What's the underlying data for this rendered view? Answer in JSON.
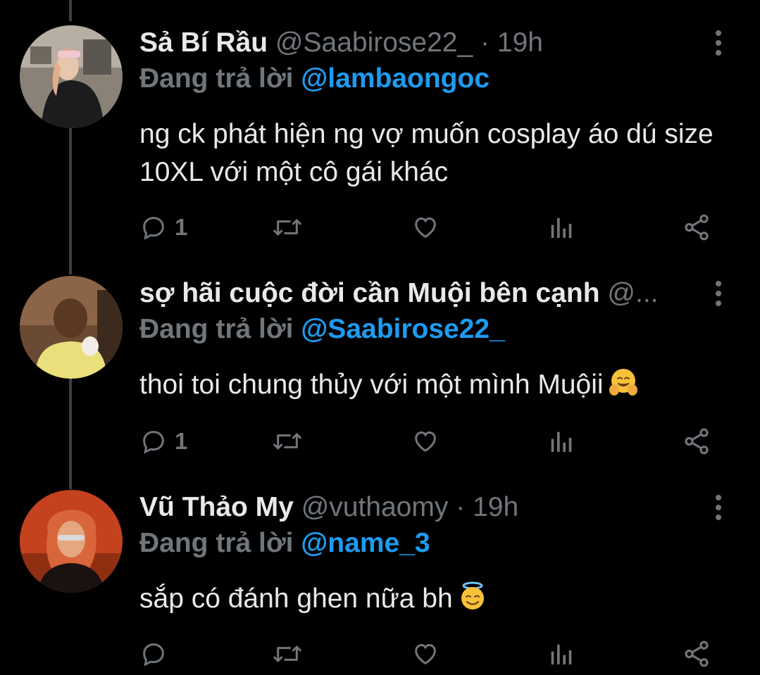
{
  "tweets": [
    {
      "name": "Sả Bí Rầu",
      "handle": "@Saabirose22_",
      "dot": "·",
      "time": "19h",
      "replying_label": "Đang trả lời",
      "replying_to": "@lambaongoc",
      "text": "ng ck phát hiện ng vợ muốn cosplay áo dú size 10XL với một cô gái khác",
      "reply_count": "1",
      "emoji": ""
    },
    {
      "name": "sợ hãi cuộc đời cần Muội bên cạnh",
      "handle": "@...",
      "dot": "",
      "time": "",
      "replying_label": "Đang trả lời",
      "replying_to": "@Saabirose22_",
      "text": "thoi toi chung thủy với một mình Muộii",
      "reply_count": "1",
      "emoji": "hugging-face-emoji"
    },
    {
      "name": "Vũ Thảo My",
      "handle": "@vuthaomy",
      "dot": "·",
      "time": "19h",
      "replying_label": "Đang trả lời",
      "replying_to": "@name_3",
      "text": "sắp có đánh ghen nữa bh",
      "reply_count": "",
      "emoji": "smiling-face-with-halo-emoji"
    }
  ],
  "icons": {
    "reply": "reply-icon",
    "retweet": "retweet-icon",
    "like": "heart-icon",
    "views": "analytics-icon",
    "share": "share-icon",
    "more": "more-vertical-icon"
  },
  "colors": {
    "background": "#000000",
    "text": "#e7e9ea",
    "secondary": "#71767b",
    "accent": "#1d9bf0",
    "thread_line": "#3e4144"
  }
}
